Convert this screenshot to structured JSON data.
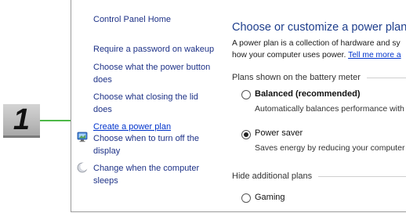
{
  "callout": {
    "number": "1"
  },
  "sidebar": {
    "home": "Control Panel Home",
    "items": [
      {
        "label": "Require a password on wakeup"
      },
      {
        "label": "Choose what the power button does"
      },
      {
        "label": "Choose what closing the lid does"
      },
      {
        "label": "Create a power plan"
      },
      {
        "label": "Choose when to turn off the display",
        "icon": "display-icon"
      },
      {
        "label": "Change when the computer sleeps",
        "icon": "moon-icon"
      }
    ]
  },
  "main": {
    "title": "Choose or customize a power plan",
    "desc_line1": "A power plan is a collection of hardware and sy",
    "desc_line2": "how your computer uses power.",
    "desc_link": "Tell me more a",
    "section_battery": "Plans shown on the battery meter",
    "plans": [
      {
        "name": "Balanced (recommended)",
        "desc": "Automatically balances performance with",
        "selected": false
      },
      {
        "name": "Power saver",
        "desc": "Saves energy by reducing your computer",
        "selected": true
      }
    ],
    "section_hidden": "Hide additional plans",
    "hidden_plans": [
      {
        "name": "Gaming",
        "selected": false
      }
    ]
  }
}
